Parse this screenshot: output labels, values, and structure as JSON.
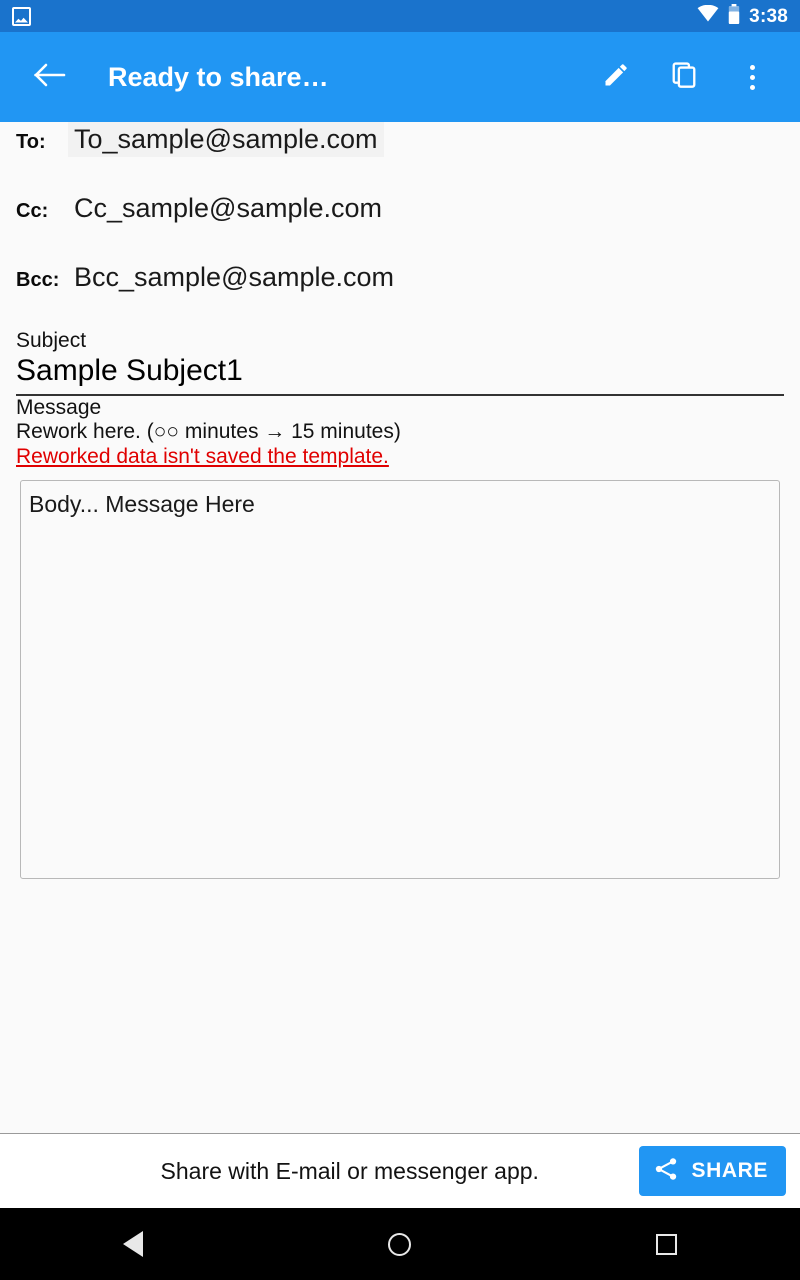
{
  "status_bar": {
    "notification_icon": "image-notification-icon",
    "wifi_icon": "wifi-icon",
    "battery_icon": "battery-icon",
    "time": "3:38",
    "background_color": "#1a73cc"
  },
  "app_bar": {
    "back_icon": "back-arrow-icon",
    "title": "Ready to share…",
    "background_color": "#2196f3",
    "actions": [
      {
        "name": "edit-button",
        "icon": "pencil-icon"
      },
      {
        "name": "copy-button",
        "icon": "copy-icon"
      },
      {
        "name": "overflow-button",
        "icon": "more-vertical-icon"
      }
    ]
  },
  "form": {
    "recipients": [
      {
        "label": "To:",
        "value": "To_sample@sample.com",
        "highlighted": true
      },
      {
        "label": "Cc:",
        "value": "Cc_sample@sample.com",
        "highlighted": false
      },
      {
        "label": "Bcc:",
        "value": "Bcc_sample@sample.com",
        "highlighted": false
      }
    ],
    "subject_label": "Subject",
    "subject_value": "Sample Subject1",
    "message_label": "Message",
    "message_note": "Rework here. (○○ minutes → 15 minutes)",
    "message_warning": "Reworked data isn't saved the template.",
    "warning_color": "#e00000",
    "body_value": "Body... Message Here"
  },
  "share_bar": {
    "hint": "Share with E-mail or messenger app.",
    "button_label": "SHARE",
    "button_icon": "share-icon",
    "button_color": "#2196f3"
  },
  "nav_bar": {
    "back": "back-triangle-icon",
    "home": "home-circle-icon",
    "recents": "recents-square-icon"
  }
}
